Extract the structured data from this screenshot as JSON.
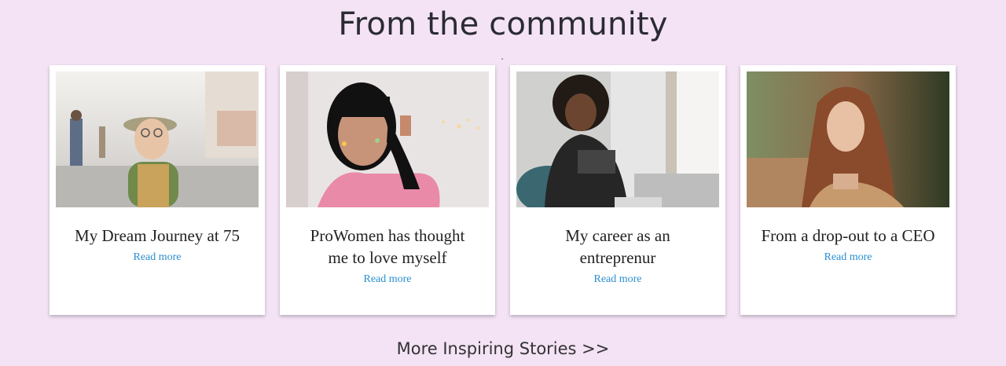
{
  "section": {
    "title": "From the community",
    "more_link": "More Inspiring Stories >>"
  },
  "cards": [
    {
      "title": "My Dream Journey at 75",
      "link": "Read more",
      "photo_icon": "elderly-woman-photo"
    },
    {
      "title": "ProWomen has thought me to love myself",
      "link": "Read more",
      "photo_icon": "woman-pink-top-photo"
    },
    {
      "title": "My career as an entreprenur",
      "link": "Read more",
      "photo_icon": "woman-curly-hair-photo"
    },
    {
      "title": "From a drop-out to a CEO",
      "link": "Read more",
      "photo_icon": "woman-long-hair-photo"
    }
  ],
  "colors": {
    "background": "#f3e3f5",
    "link": "#2a8fd0",
    "title": "#2b2b33"
  }
}
